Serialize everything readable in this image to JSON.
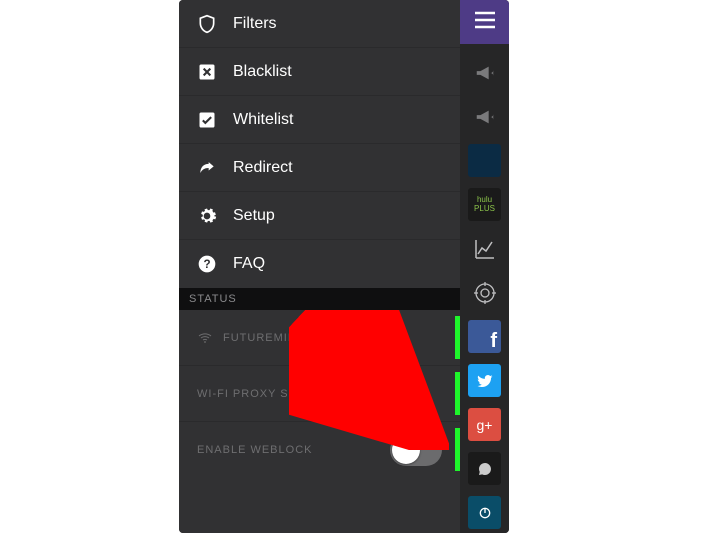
{
  "menu": {
    "items": [
      {
        "label": "Filters",
        "icon": "shield-icon"
      },
      {
        "label": "Blacklist",
        "icon": "x-box-icon"
      },
      {
        "label": "Whitelist",
        "icon": "check-box-icon"
      },
      {
        "label": "Redirect",
        "icon": "redirect-arrow-icon"
      },
      {
        "label": "Setup",
        "icon": "gear-icon"
      },
      {
        "label": "FAQ",
        "icon": "question-circle-icon"
      }
    ]
  },
  "status": {
    "header": "STATUS",
    "rows": [
      {
        "label": "FUTUREMIND",
        "icon": "wifi-icon",
        "has_bar": true,
        "has_toggle": false
      },
      {
        "label": "WI-FI PROXY SETUP",
        "icon": null,
        "has_bar": true,
        "has_toggle": false
      },
      {
        "label": "ENABLE WEBLOCK",
        "icon": null,
        "has_bar": true,
        "has_toggle": true,
        "toggle_on": false
      }
    ]
  },
  "rail": {
    "items": [
      {
        "name": "megaphone-icon"
      },
      {
        "name": "megaphone-icon"
      },
      {
        "name": "app-tile-pandora"
      },
      {
        "name": "app-tile-hulu-plus",
        "label": "hulu PLUS"
      },
      {
        "name": "graph-icon"
      },
      {
        "name": "target-icon"
      },
      {
        "name": "app-tile-facebook",
        "label": "f"
      },
      {
        "name": "app-tile-twitter"
      },
      {
        "name": "app-tile-google-plus",
        "label": "g+"
      },
      {
        "name": "app-tile-disqus"
      },
      {
        "name": "app-tile-generic"
      }
    ]
  }
}
